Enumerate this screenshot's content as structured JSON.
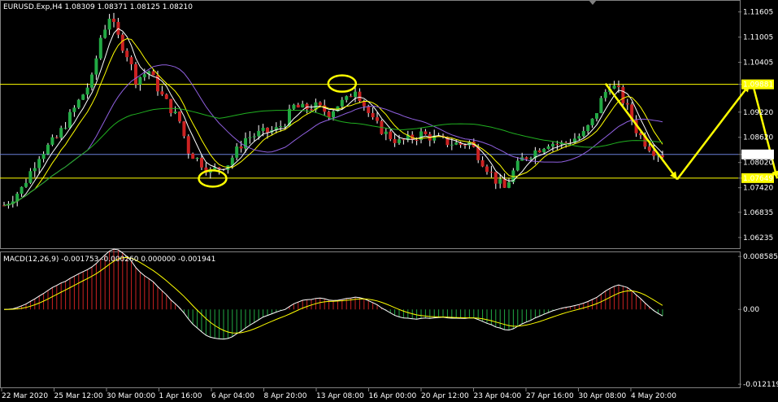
{
  "chart_data": {
    "type": "candlestick",
    "symbol_header": "EURUSD.Exp,H4  1.08309 1.08371 1.08125 1.08210",
    "ylim": [
      1.06,
      1.1185
    ],
    "y_ticks": [
      "1.11605",
      "1.11005",
      "1.10405",
      "1.09881",
      "1.09220",
      "1.08620",
      "1.08213",
      "1.08020",
      "1.07649",
      "1.07420",
      "1.06835",
      "1.06235"
    ],
    "highlighted_levels": [
      {
        "value": "1.09881",
        "color": "#ffff00"
      },
      {
        "value": "1.07649",
        "color": "#ffff00"
      },
      {
        "value": "1.08213",
        "color": "#6a7fd8"
      }
    ],
    "x_labels": [
      "22 Mar 2020",
      "25 Mar 12:00",
      "30 Mar 00:00",
      "1 Apr 16:00",
      "6 Apr 04:00",
      "8 Apr 20:00",
      "13 Apr 08:00",
      "16 Apr 00:00",
      "20 Apr 12:00",
      "23 Apr 04:00",
      "27 Apr 16:00",
      "30 Apr 08:00",
      "4 May 20:00"
    ],
    "price_path": [
      [
        0,
        1.07
      ],
      [
        4,
        1.074
      ],
      [
        8,
        1.082
      ],
      [
        12,
        1.086
      ],
      [
        16,
        1.093
      ],
      [
        20,
        1.1
      ],
      [
        22,
        1.11
      ],
      [
        24,
        1.115
      ],
      [
        26,
        1.11
      ],
      [
        28,
        1.106
      ],
      [
        30,
        1.1
      ],
      [
        33,
        1.102
      ],
      [
        36,
        1.096
      ],
      [
        40,
        1.09
      ],
      [
        42,
        1.083
      ],
      [
        45,
        1.08
      ],
      [
        47,
        1.078
      ],
      [
        49,
        1.079
      ],
      [
        51,
        1.08
      ],
      [
        55,
        1.086
      ],
      [
        58,
        1.087
      ],
      [
        62,
        1.088
      ],
      [
        64,
        1.09
      ],
      [
        66,
        1.0935
      ],
      [
        68,
        1.093
      ],
      [
        71,
        1.0935
      ],
      [
        74,
        1.092
      ],
      [
        76,
        1.094
      ],
      [
        78,
        1.095
      ],
      [
        80,
        1.098
      ],
      [
        82,
        1.094
      ],
      [
        84,
        1.09
      ],
      [
        87,
        1.087
      ],
      [
        90,
        1.085
      ],
      [
        93,
        1.086
      ],
      [
        95,
        1.087
      ],
      [
        98,
        1.086
      ],
      [
        101,
        1.085
      ],
      [
        104,
        1.0845
      ],
      [
        106,
        1.085
      ],
      [
        108,
        1.082
      ],
      [
        110,
        1.079
      ],
      [
        112,
        1.076
      ],
      [
        114,
        1.074
      ],
      [
        116,
        1.078
      ],
      [
        118,
        1.081
      ],
      [
        121,
        1.083
      ],
      [
        124,
        1.085
      ],
      [
        127,
        1.0845
      ],
      [
        130,
        1.086
      ],
      [
        132,
        1.087
      ],
      [
        134,
        1.09
      ],
      [
        136,
        1.095
      ],
      [
        138,
        1.099
      ],
      [
        140,
        1.097
      ],
      [
        142,
        1.093
      ],
      [
        144,
        1.088
      ],
      [
        146,
        1.085
      ],
      [
        148,
        1.083
      ],
      [
        150,
        1.0821
      ]
    ],
    "macd": {
      "label": "MACD(12,26,9) -0.001753 -0.000260 0.000000 -0.001941",
      "ylim": [
        -0.0125,
        0.009
      ],
      "y_ticks": [
        "0.008585",
        "0.00",
        "-0.012119"
      ]
    }
  },
  "colors": {
    "bull": "#22aa44",
    "bear": "#cc2222",
    "wick": "#ffffff",
    "grid": "#666666",
    "yellow": "#ffff00",
    "purple": "#9060e0",
    "green_ma": "#20b020",
    "blue_level": "#6a7fd8"
  }
}
